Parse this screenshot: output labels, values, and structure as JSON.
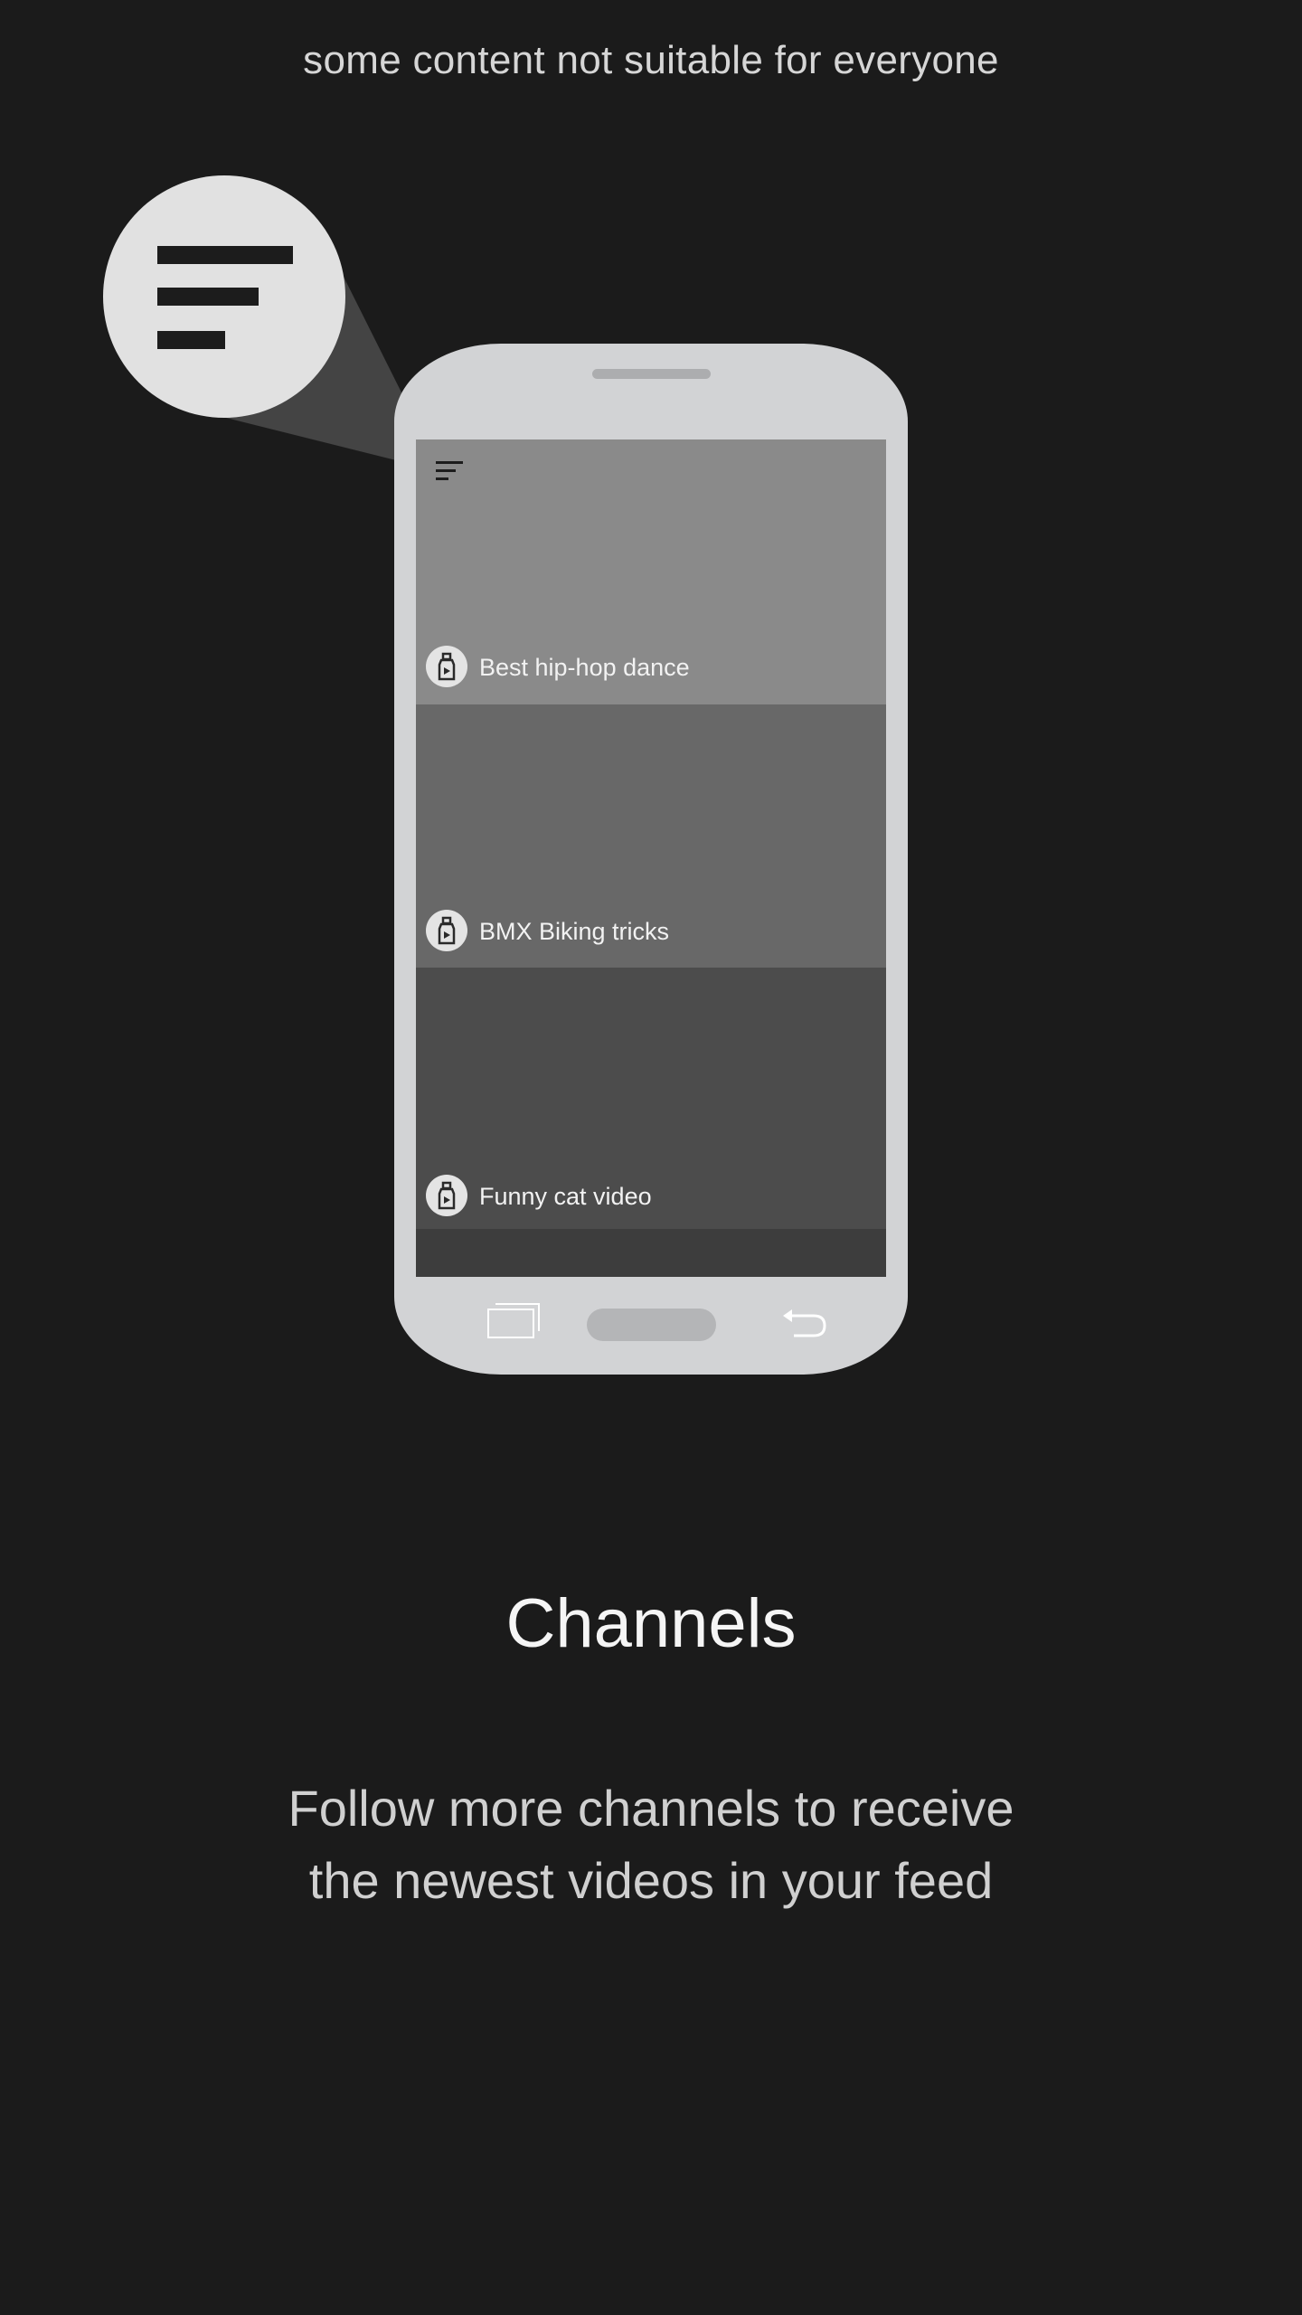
{
  "caption": "some content not suitable for everyone",
  "zoom_bubble": {
    "icon": "menu-icon"
  },
  "screen": {
    "menu_icon": "menu-icon",
    "channels": [
      {
        "title": "Best hip-hop dance",
        "icon": "bottle-icon"
      },
      {
        "title": "BMX Biking tricks",
        "icon": "bottle-icon"
      },
      {
        "title": "Funny cat video",
        "icon": "bottle-icon"
      }
    ]
  },
  "navigation": {
    "recent_icon": "recent-apps-icon",
    "home_icon": "home-button",
    "back_icon": "back-arrow-icon"
  },
  "heading": "Channels",
  "description": {
    "line1": "Follow more channels to receive",
    "line2": "the newest videos in your feed"
  }
}
